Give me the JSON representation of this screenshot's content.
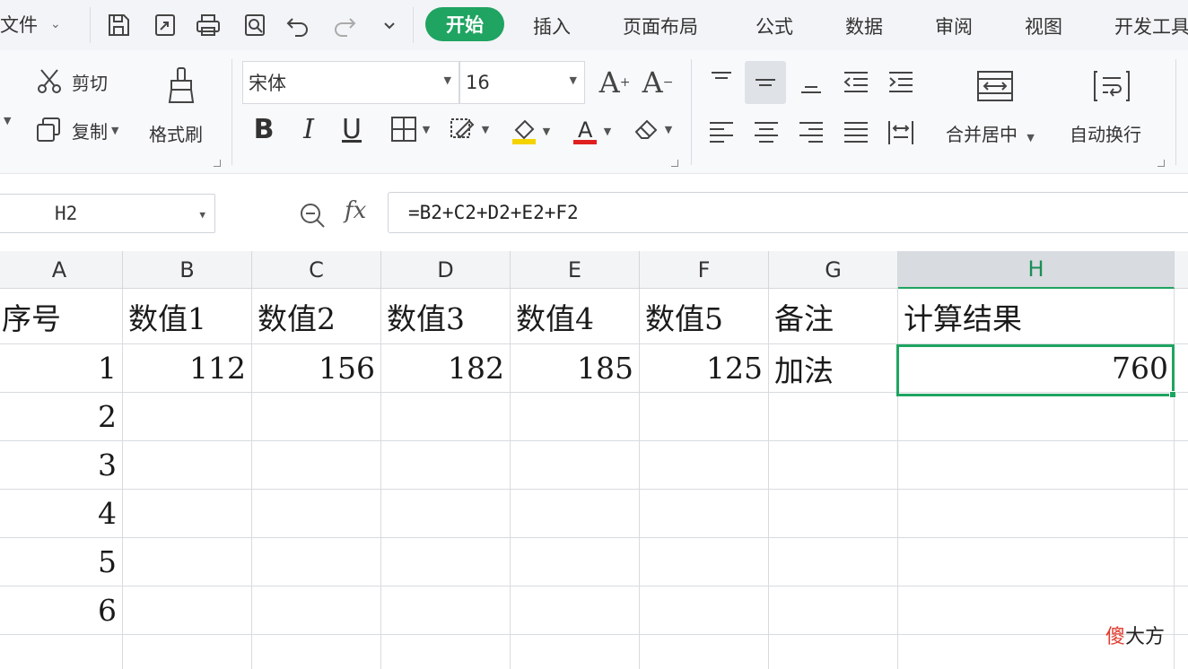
{
  "menu": {
    "file_label": "文件",
    "tabs": [
      "开始",
      "插入",
      "页面布局",
      "公式",
      "数据",
      "审阅",
      "视图",
      "开发工具"
    ],
    "active_tab": "开始"
  },
  "quick_access": [
    "save-icon",
    "export-icon",
    "print-icon",
    "print-preview-icon",
    "undo-icon",
    "redo-icon",
    "customize-icon"
  ],
  "ribbon": {
    "cut_label": "剪切",
    "copy_label": "复制",
    "format_painter_label": "格式刷",
    "font_name": "宋体",
    "font_size": "16",
    "merge_center_label": "合并居中",
    "wrap_text_label": "自动换行",
    "accent_color": "#1fa461",
    "font_color": "#e02020",
    "fill_color": "#f5d300"
  },
  "formula_bar": {
    "name_box": "H2",
    "fx_label": "fx",
    "formula": "=B2+C2+D2+E2+F2"
  },
  "sheet": {
    "columns": [
      "A",
      "B",
      "C",
      "D",
      "E",
      "F",
      "G",
      "H"
    ],
    "active_column": "H",
    "active_cell": "H2",
    "rows": [
      [
        "序号",
        "数值1",
        "数值2",
        "数值3",
        "数值4",
        "数值5",
        "备注",
        "计算结果"
      ],
      [
        "1",
        "112",
        "156",
        "182",
        "185",
        "125",
        "加法",
        "760"
      ],
      [
        "2",
        "",
        "",
        "",
        "",
        "",
        "",
        ""
      ],
      [
        "3",
        "",
        "",
        "",
        "",
        "",
        "",
        ""
      ],
      [
        "4",
        "",
        "",
        "",
        "",
        "",
        "",
        ""
      ],
      [
        "5",
        "",
        "",
        "",
        "",
        "",
        "",
        ""
      ],
      [
        "6",
        "",
        "",
        "",
        "",
        "",
        "",
        ""
      ],
      [
        "",
        "",
        "",
        "",
        "",
        "",
        "",
        ""
      ]
    ]
  },
  "watermark": {
    "first": "傻",
    "rest": "大方"
  }
}
